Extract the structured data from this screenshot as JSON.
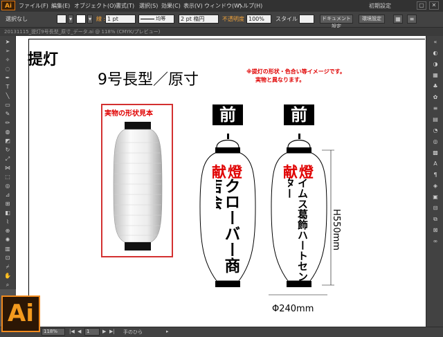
{
  "app": {
    "logo": "Ai",
    "workspace": "初期設定"
  },
  "menu": {
    "items": [
      "ファイル(F)",
      "編集(E)",
      "オブジェクト(O)",
      "書式(T)",
      "選択(S)",
      "効果(C)",
      "表示(V)",
      "ウィンドウ(W)",
      "ヘルプ(H)"
    ]
  },
  "window_controls": [
    "▢",
    "✕"
  ],
  "control_bar": {
    "selection": "選択なし",
    "stroke_label": "線 :",
    "stroke_weight": "1 pt",
    "stroke_style": "均等",
    "brush": "2 pt 楕円",
    "opacity_label": "不透明度 :",
    "opacity": "100%",
    "style_label": "スタイル :",
    "doc_settings": "ドキュメント設定",
    "prefs": "環境設定"
  },
  "doc_tab": {
    "title": "20131115_提灯9号長型_原寸_データ.ai @ 118% (CMYK/プレビュー)"
  },
  "artwork": {
    "title": "提灯",
    "subtitle": "9号長型／原寸",
    "note_line1": "※提灯の形状・色合い等イメージです。",
    "note_line2": "実物と異なります。",
    "sample_label": "実物の形状見本",
    "lantern1": {
      "front": "前",
      "top_text": "献燈",
      "vertical_text": "クローバー商店会"
    },
    "lantern2": {
      "front": "前",
      "top_text": "献燈",
      "vertical_text": "イムス葛飾ハートセンター"
    },
    "height_dim": "H550mm",
    "width_dim": "Φ240mm",
    "colors": {
      "red": "#e00000",
      "sample_border": "#d33030",
      "orange": "#f08a1e"
    }
  },
  "status_bar": {
    "zoom": "118%",
    "page": "1",
    "tool": "手のひら"
  },
  "icons": {
    "badge": "Ai"
  }
}
